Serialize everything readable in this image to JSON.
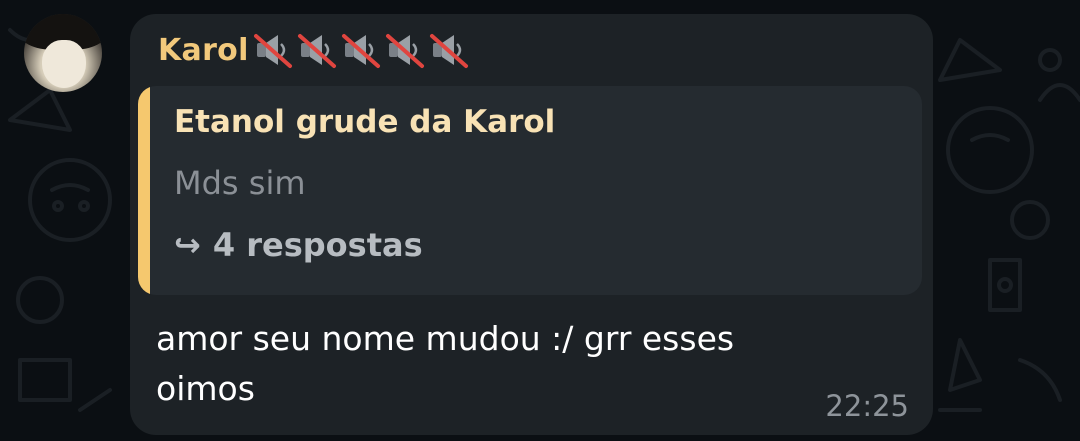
{
  "chat": {
    "sender": {
      "name": "Karol",
      "emoji_icons": [
        "muted-speaker-icon",
        "muted-speaker-icon",
        "muted-speaker-icon",
        "muted-speaker-icon",
        "muted-speaker-icon"
      ]
    },
    "quote": {
      "title": "Etanol grude da Karol",
      "text": "Mds sim",
      "replies_arrow": "↪",
      "replies_label": "4 respostas"
    },
    "message": {
      "text": "amor seu nome mudou :/ grr esses oimos",
      "time": "22:25"
    }
  },
  "colors": {
    "background": "#0b0f13",
    "bubble": "#1d2226",
    "quote_bg": "#252b30",
    "accent": "#f5c86e",
    "sender_name": "#f2c97c",
    "quote_title": "#f8e2b5",
    "muted_text": "#8b9096",
    "message_text": "#ffffff",
    "timestamp": "#8e949a"
  }
}
